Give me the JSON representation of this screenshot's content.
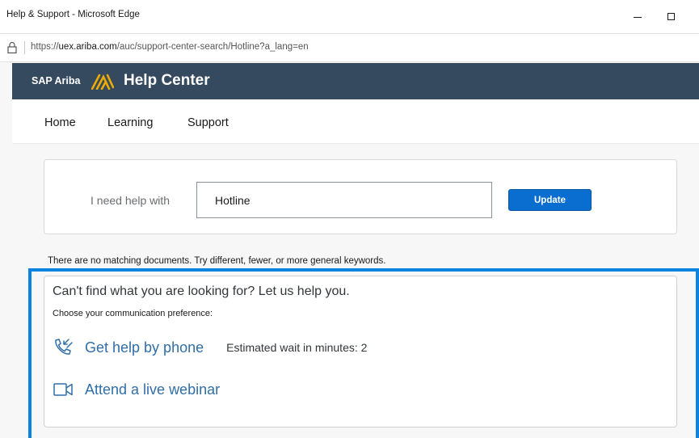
{
  "window": {
    "title": "Help & Support - Microsoft Edge"
  },
  "browser": {
    "url_prefix": "https://",
    "url_domain": "uex.ariba.com",
    "url_path": "/auc/support-center-search/Hotline?a_lang=en"
  },
  "header": {
    "brand": "SAP Ariba",
    "title": "Help Center",
    "logo_color": "#f0ab00",
    "background_color": "#354a5f"
  },
  "nav": {
    "items": [
      {
        "label": "Home"
      },
      {
        "label": "Learning"
      },
      {
        "label": "Support"
      }
    ]
  },
  "search": {
    "label": "I need help with",
    "value": "Hotline",
    "button_label": "Update"
  },
  "results": {
    "message": "There are no matching documents. Try different, fewer, or more general keywords."
  },
  "help": {
    "heading": "Can't find what you are looking for? Let us help you.",
    "subheading": "Choose your communication preference:",
    "phone_label": "Get help by phone",
    "phone_icon": "phone-icon",
    "wait_text": "Estimated wait in minutes: 2",
    "webinar_label": "Attend a live webinar",
    "webinar_icon": "video-camera-icon",
    "link_color": "#2f6ea7",
    "highlight_color": "#0a84e0"
  }
}
